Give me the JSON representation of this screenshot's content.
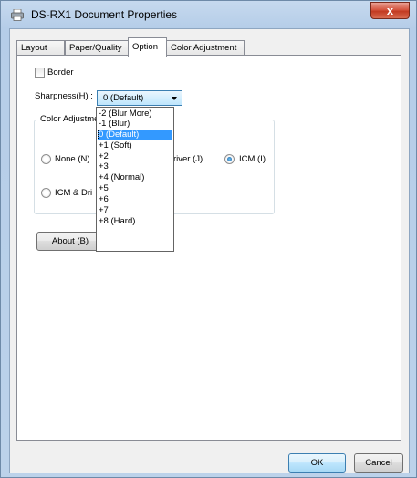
{
  "window": {
    "title": "DS-RX1 Document Properties",
    "close_label": "x"
  },
  "tabs": [
    {
      "label": "Layout"
    },
    {
      "label": "Paper/Quality"
    },
    {
      "label": "Option"
    },
    {
      "label": "Color Adjustment"
    }
  ],
  "active_tab": "Option",
  "option": {
    "border_label": "Border",
    "border_checked": false,
    "sharpness_label": "Sharpness(H) :",
    "sharpness_value": "0 (Default)",
    "color_adjustment_group": "Color Adjustme",
    "radio_none": "None (N)",
    "radio_driver": "river (J)",
    "radio_icm": "ICM (I)",
    "radio_icm_driver": "ICM & Dri",
    "selected_radio": "ICM (I)",
    "about_button": "About (B)"
  },
  "sharpness_options": [
    "-2 (Blur More)",
    "-1 (Blur)",
    "0 (Default)",
    "+1 (Soft)",
    "+2",
    "+3",
    "+4 (Normal)",
    "+5",
    "+6",
    "+7",
    "+8 (Hard)"
  ],
  "footer": {
    "ok": "OK",
    "cancel": "Cancel"
  }
}
